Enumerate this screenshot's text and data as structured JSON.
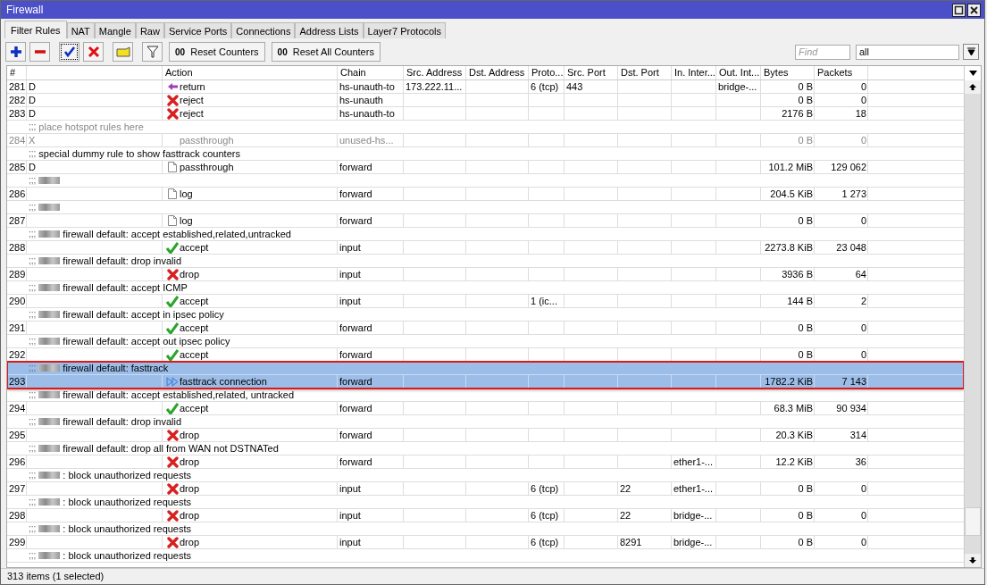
{
  "window": {
    "title": "Firewall"
  },
  "tabs": [
    {
      "label": "Filter Rules",
      "selected": true
    },
    {
      "label": "NAT",
      "selected": false
    },
    {
      "label": "Mangle",
      "selected": false
    },
    {
      "label": "Raw",
      "selected": false
    },
    {
      "label": "Service Ports",
      "selected": false
    },
    {
      "label": "Connections",
      "selected": false
    },
    {
      "label": "Address Lists",
      "selected": false
    },
    {
      "label": "Layer7 Protocols",
      "selected": false
    }
  ],
  "toolbar": {
    "tools": [
      {
        "kind": "add"
      },
      {
        "kind": "remove"
      },
      {
        "kind": "enable",
        "focused": true
      },
      {
        "kind": "disable",
        "focused": false
      },
      {
        "kind": "comment"
      },
      {
        "kind": "filter"
      }
    ],
    "buttons": [
      {
        "icon": "00",
        "label": "Reset Counters"
      },
      {
        "icon": "00",
        "label": "Reset All Counters"
      }
    ],
    "find": {
      "placeholder": "Find"
    },
    "filter_value": "all"
  },
  "table": {
    "columns": [
      "#",
      "",
      "Action",
      "Chain",
      "Src. Address",
      "Dst. Address",
      "Proto...",
      "Src. Port",
      "Dst. Port",
      "In. Inter...",
      "Out. Int...",
      "Bytes",
      "Packets"
    ],
    "entries": [
      {
        "number": "281",
        "flags": "D",
        "action": {
          "kind": "return",
          "label": "return"
        },
        "chain": "hs-unauth-to",
        "cells": {
          "src_address": "173.222.11...",
          "proto": "6 (tcp)",
          "src_port": "443",
          "out_interface": "bridge-..."
        },
        "bytes": "0 B",
        "packets": "0",
        "disabled": false,
        "selected": false
      },
      {
        "number": "282",
        "flags": "D",
        "action": {
          "kind": "reject",
          "label": "reject"
        },
        "chain": "hs-unauth",
        "bytes": "0 B",
        "packets": "0",
        "disabled": false,
        "selected": false
      },
      {
        "number": "283",
        "flags": "D",
        "action": {
          "kind": "reject",
          "label": "reject"
        },
        "chain": "hs-unauth-to",
        "bytes": "2176 B",
        "packets": "18",
        "disabled": false,
        "selected": false
      },
      {
        "comment": {
          "marker": ";;;",
          "redacted": false,
          "text": "place hotspot rules here"
        },
        "number": "284",
        "flags": "X",
        "action": {
          "kind": "plain",
          "label": "passthrough"
        },
        "chain": "unused-hs...",
        "bytes": "0 B",
        "packets": "0",
        "disabled": true,
        "selected": false
      },
      {
        "comment": {
          "marker": ";;;",
          "redacted": false,
          "text": "special dummy rule to show fasttrack counters"
        },
        "number": "285",
        "flags": "D",
        "action": {
          "kind": "passthrough",
          "label": "passthrough"
        },
        "chain": "forward",
        "bytes": "101.2 MiB",
        "packets": "129 062",
        "disabled": false,
        "selected": false
      },
      {
        "comment": {
          "marker": ";;;",
          "redacted": true
        },
        "number": "286",
        "action": {
          "kind": "log",
          "label": "log"
        },
        "chain": "forward",
        "bytes": "204.5 KiB",
        "packets": "1 273",
        "disabled": false,
        "selected": false
      },
      {
        "comment": {
          "marker": ";;;",
          "redacted": true
        },
        "number": "287",
        "action": {
          "kind": "log",
          "label": "log"
        },
        "chain": "forward",
        "bytes": "0 B",
        "packets": "0",
        "disabled": false,
        "selected": false
      },
      {
        "comment": {
          "marker": ";;;",
          "redacted": true,
          "text": "firewall default: accept established,related,untracked"
        },
        "number": "288",
        "action": {
          "kind": "accept",
          "label": "accept"
        },
        "chain": "input",
        "bytes": "2273.8 KiB",
        "packets": "23 048",
        "disabled": false,
        "selected": false
      },
      {
        "comment": {
          "marker": ";;;",
          "redacted": true,
          "text": "firewall default: drop invalid"
        },
        "number": "289",
        "action": {
          "kind": "drop",
          "label": "drop"
        },
        "chain": "input",
        "bytes": "3936 B",
        "packets": "64",
        "disabled": false,
        "selected": false
      },
      {
        "comment": {
          "marker": ";;;",
          "redacted": true,
          "text": "firewall default: accept ICMP"
        },
        "number": "290",
        "action": {
          "kind": "accept",
          "label": "accept"
        },
        "chain": "input",
        "cells": {
          "proto": "1 (ic..."
        },
        "bytes": "144 B",
        "packets": "2",
        "disabled": false,
        "selected": false
      },
      {
        "comment": {
          "marker": ";;;",
          "redacted": true,
          "text": "firewall default: accept in ipsec policy"
        },
        "number": "291",
        "action": {
          "kind": "accept",
          "label": "accept"
        },
        "chain": "forward",
        "bytes": "0 B",
        "packets": "0",
        "disabled": false,
        "selected": false
      },
      {
        "comment": {
          "marker": ";;;",
          "redacted": true,
          "text": "firewall default: accept out ipsec policy"
        },
        "number": "292",
        "action": {
          "kind": "accept",
          "label": "accept"
        },
        "chain": "forward",
        "bytes": "0 B",
        "packets": "0",
        "disabled": false,
        "selected": false
      },
      {
        "comment": {
          "marker": ";;;",
          "redacted": true,
          "text": "firewall default: fasttrack"
        },
        "number": "293",
        "action": {
          "kind": "fasttrack",
          "label": "fasttrack connection"
        },
        "chain": "forward",
        "bytes": "1782.2 KiB",
        "packets": "7 143",
        "disabled": false,
        "selected": true
      },
      {
        "comment": {
          "marker": ";;;",
          "redacted": true,
          "text": "firewall default: accept established,related, untracked"
        },
        "number": "294",
        "action": {
          "kind": "accept",
          "label": "accept"
        },
        "chain": "forward",
        "bytes": "68.3 MiB",
        "packets": "90 934",
        "disabled": false,
        "selected": false
      },
      {
        "comment": {
          "marker": ";;;",
          "redacted": true,
          "text": "firewall default: drop invalid"
        },
        "number": "295",
        "action": {
          "kind": "drop",
          "label": "drop"
        },
        "chain": "forward",
        "bytes": "20.3 KiB",
        "packets": "314",
        "disabled": false,
        "selected": false
      },
      {
        "comment": {
          "marker": ";;;",
          "redacted": true,
          "text": "firewall default:  drop all from WAN not DSTNATed"
        },
        "number": "296",
        "action": {
          "kind": "drop",
          "label": "drop"
        },
        "chain": "forward",
        "cells": {
          "in_interface": "ether1-..."
        },
        "bytes": "12.2 KiB",
        "packets": "36",
        "disabled": false,
        "selected": false
      },
      {
        "comment": {
          "marker": ";;;",
          "redacted": true,
          "text": ": block unauthorized requests"
        },
        "number": "297",
        "action": {
          "kind": "drop",
          "label": "drop"
        },
        "chain": "input",
        "cells": {
          "proto": "6 (tcp)",
          "dst_port": "22",
          "in_interface": "ether1-..."
        },
        "bytes": "0 B",
        "packets": "0",
        "disabled": false,
        "selected": false
      },
      {
        "comment": {
          "marker": ";;;",
          "redacted": true,
          "text": ": block unauthorized requests"
        },
        "number": "298",
        "action": {
          "kind": "drop",
          "label": "drop"
        },
        "chain": "input",
        "cells": {
          "proto": "6 (tcp)",
          "dst_port": "22",
          "in_interface": "bridge-..."
        },
        "bytes": "0 B",
        "packets": "0",
        "disabled": false,
        "selected": false
      },
      {
        "comment": {
          "marker": ";;;",
          "redacted": true,
          "text": ": block unauthorized requests"
        },
        "number": "299",
        "action": {
          "kind": "drop",
          "label": "drop"
        },
        "chain": "input",
        "cells": {
          "proto": "6 (tcp)",
          "dst_port": "8291",
          "in_interface": "bridge-..."
        },
        "bytes": "0 B",
        "packets": "0",
        "disabled": false,
        "selected": false
      },
      {
        "comment": {
          "marker": ";;;",
          "redacted": true,
          "text": ": block unauthorized requests"
        },
        "disabled": false,
        "selected": false
      }
    ]
  },
  "status_bar": {
    "text": "313 items (1 selected)"
  }
}
